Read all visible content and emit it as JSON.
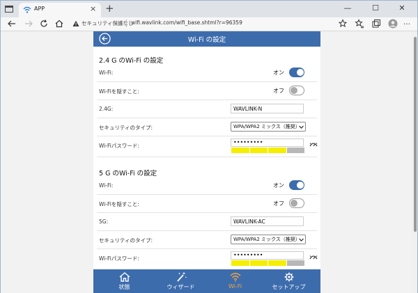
{
  "browser": {
    "tab_title": "APP",
    "tab_close": "×",
    "new_tab": "+",
    "security_text": "セキュリティ保護なし",
    "url": "wifi.wavlink.com/wifi_base.shtml?r=96359",
    "minimize": "—",
    "maximize": "☐",
    "close": "✕"
  },
  "panel": {
    "title": "Wi-Fi の設定"
  },
  "sections": [
    {
      "title": "2.4 G のWi-Fi の設定",
      "wifi_label": "Wi-Fi:",
      "wifi_state": "オン",
      "wifi_on": true,
      "hide_label": "Wi-Fiを隠すこと:",
      "hide_state": "オフ",
      "hide_on": false,
      "ssid_label": "2.4G:",
      "ssid_value": "WAVLINK-N",
      "security_label": "セキュリティのタイプ:",
      "security_value": "WPA/WPA2 ミックス（推奨）",
      "password_label": "Wi-Fiパスワード:",
      "password_value": "•••••••••"
    },
    {
      "title": "5 G のWi-Fi の設定",
      "wifi_label": "Wi-Fi:",
      "wifi_state": "オン",
      "wifi_on": true,
      "hide_label": "Wi-Fiを隠すこと:",
      "hide_state": "オフ",
      "hide_on": false,
      "ssid_label": "5G:",
      "ssid_value": "WAVLINK-AC",
      "security_label": "セキュリティのタイプ:",
      "security_value": "WPA/WPA2 ミックス（推奨）",
      "password_label": "Wi-Fiパスワード:",
      "password_value": "•••••••••"
    }
  ],
  "password_strength_colors": [
    "#f5ee00",
    "#f5ee00",
    "#f5ee00",
    "#b8b8b8"
  ],
  "colors": {
    "accent": "#3d6cad",
    "active_tab": "#f3a43c"
  },
  "bottom_tabs": [
    {
      "label": "状態",
      "icon": "home-icon"
    },
    {
      "label": "ウィザード",
      "icon": "magic-wand-icon"
    },
    {
      "label": "Wi-Fi",
      "icon": "wifi-icon",
      "active": true
    },
    {
      "label": "セットアップ",
      "icon": "gear-icon"
    }
  ]
}
